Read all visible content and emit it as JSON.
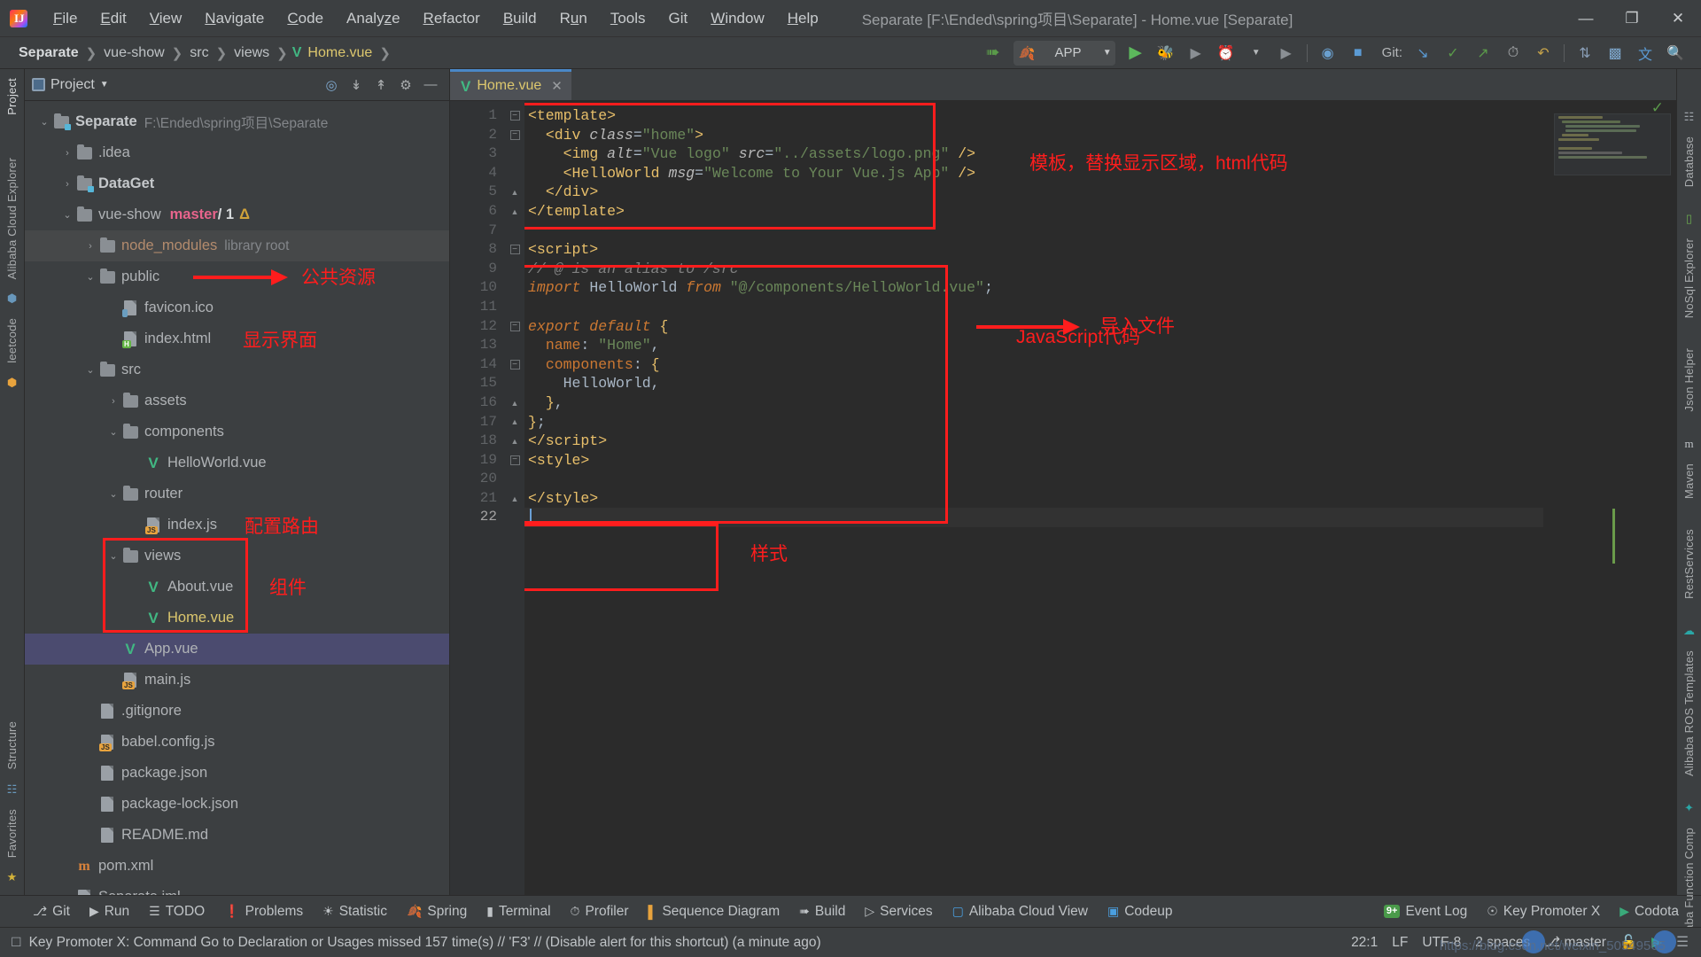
{
  "titlebar": {
    "app_icon": "intellij-idea-logo",
    "menus": [
      "File",
      "Edit",
      "View",
      "Navigate",
      "Code",
      "Analyze",
      "Refactor",
      "Build",
      "Run",
      "Tools",
      "Git",
      "Window",
      "Help"
    ],
    "window_title": "Separate [F:\\Ended\\spring项目\\Separate] - Home.vue [Separate]",
    "minimize": "—",
    "maximize": "❐",
    "close": "✕"
  },
  "navbar": {
    "breadcrumb": [
      "Separate",
      "vue-show",
      "src",
      "views",
      "Home.vue"
    ],
    "separator": "❯",
    "run_config_name": "APP",
    "git_label": "Git:",
    "icons": [
      "build-icon",
      "vcs-update-icon",
      "run-icon",
      "debug-icon",
      "coverage-icon",
      "profiler-icon",
      "run-anything-icon",
      "stop-icon",
      "help-icon",
      "settings-icon",
      "git-commit-icon",
      "git-push-icon",
      "git-pull-icon",
      "history-icon",
      "undo-icon",
      "compare-icon",
      "bookmark-icon",
      "translate-icon",
      "search-icon"
    ]
  },
  "left_rail": {
    "top": [
      "Project"
    ],
    "side": [
      "Alibaba Cloud Explorer",
      "leetcode"
    ],
    "bottom": [
      "Structure",
      "Favorites"
    ]
  },
  "project_panel": {
    "title": "Project",
    "actions": [
      "locate-icon",
      "collapse-all-icon",
      "expand-icon",
      "settings-icon",
      "hide-icon"
    ],
    "tree": [
      {
        "depth": 0,
        "arrow": "down",
        "icon": "folder-module",
        "label": "Separate",
        "bold": true,
        "sub": "F:\\Ended\\spring项目\\Separate"
      },
      {
        "depth": 1,
        "arrow": "right",
        "icon": "folder",
        "label": ".idea"
      },
      {
        "depth": 1,
        "arrow": "right",
        "icon": "folder-module",
        "label": "DataGet",
        "bold": true
      },
      {
        "depth": 1,
        "arrow": "down",
        "icon": "folder",
        "label": "vue-show",
        "branch": "master",
        "branch_num": "/ 1",
        "branch_delta": "Δ"
      },
      {
        "depth": 2,
        "arrow": "right",
        "icon": "folder",
        "label": "node_modules",
        "brown": true,
        "sub": "library root",
        "highlight": true
      },
      {
        "depth": 2,
        "arrow": "down",
        "icon": "folder",
        "label": "public"
      },
      {
        "depth": 3,
        "arrow": "none",
        "icon": "file-image",
        "label": "favicon.ico"
      },
      {
        "depth": 3,
        "arrow": "none",
        "icon": "file-html",
        "label": "index.html"
      },
      {
        "depth": 2,
        "arrow": "down",
        "icon": "folder",
        "label": "src"
      },
      {
        "depth": 3,
        "arrow": "right",
        "icon": "folder",
        "label": "assets"
      },
      {
        "depth": 3,
        "arrow": "down",
        "icon": "folder",
        "label": "components"
      },
      {
        "depth": 4,
        "arrow": "none",
        "icon": "vue",
        "label": "HelloWorld.vue"
      },
      {
        "depth": 3,
        "arrow": "down",
        "icon": "folder",
        "label": "router"
      },
      {
        "depth": 4,
        "arrow": "none",
        "icon": "file-js",
        "label": "index.js"
      },
      {
        "depth": 3,
        "arrow": "down",
        "icon": "folder",
        "label": "views"
      },
      {
        "depth": 4,
        "arrow": "none",
        "icon": "vue",
        "label": "About.vue"
      },
      {
        "depth": 4,
        "arrow": "none",
        "icon": "vue",
        "label": "Home.vue",
        "yellow": true
      },
      {
        "depth": 3,
        "arrow": "none",
        "icon": "vue",
        "label": "App.vue",
        "selected": true
      },
      {
        "depth": 3,
        "arrow": "none",
        "icon": "file-js",
        "label": "main.js"
      },
      {
        "depth": 2,
        "arrow": "none",
        "icon": "file-ignore",
        "label": ".gitignore"
      },
      {
        "depth": 2,
        "arrow": "none",
        "icon": "file-js",
        "label": "babel.config.js"
      },
      {
        "depth": 2,
        "arrow": "none",
        "icon": "file-json",
        "label": "package.json"
      },
      {
        "depth": 2,
        "arrow": "none",
        "icon": "file-json",
        "label": "package-lock.json"
      },
      {
        "depth": 2,
        "arrow": "none",
        "icon": "file-md",
        "label": "README.md"
      },
      {
        "depth": 1,
        "arrow": "none",
        "icon": "maven",
        "label": "pom.xml"
      },
      {
        "depth": 1,
        "arrow": "none",
        "icon": "file",
        "label": "Separate.iml"
      }
    ]
  },
  "editor": {
    "tab": {
      "label": "Home.vue",
      "icon": "vue-icon",
      "close": "✕"
    },
    "caret_position": "22:1",
    "lines": [
      {
        "n": 1,
        "fold": "minus",
        "html": "<span class='k-tag'>&lt;template&gt;</span>"
      },
      {
        "n": 2,
        "fold": "minus",
        "html": "  <span class='k-tag'>&lt;div </span><span class='k-attr'>class</span><span class='k-eq'>=</span><span class='k-str'>\"home\"</span><span class='k-tag'>&gt;</span>"
      },
      {
        "n": 3,
        "fold": "",
        "html": "    <span class='k-tag'>&lt;img </span><span class='k-attr'>alt</span><span class='k-eq'>=</span><span class='k-str'>\"Vue logo\"</span> <span class='k-attr'>src</span><span class='k-eq'>=</span><span class='k-str'>\"../assets/logo.png\"</span> <span class='k-tag'>/&gt;</span>"
      },
      {
        "n": 4,
        "fold": "",
        "html": "    <span class='k-tag'>&lt;HelloWorld </span><span class='k-attr'>msg</span><span class='k-eq'>=</span><span class='k-str'>\"Welcome to Your Vue.js App\"</span> <span class='k-tag'>/&gt;</span>"
      },
      {
        "n": 5,
        "fold": "plus-end",
        "html": "  <span class='k-tag'>&lt;/div&gt;</span>"
      },
      {
        "n": 6,
        "fold": "plus-end",
        "html": "<span class='k-tag'>&lt;/template&gt;</span>"
      },
      {
        "n": 7,
        "fold": "",
        "html": ""
      },
      {
        "n": 8,
        "fold": "minus",
        "html": "<span class='k-tag'>&lt;script&gt;</span>"
      },
      {
        "n": 9,
        "fold": "",
        "html": "<span class='k-cmt'>// @ is an alias to /src</span>"
      },
      {
        "n": 10,
        "fold": "",
        "html": "<span class='k-kw'>import</span> <span class='k-id'>HelloWorld</span> <span class='k-kw'>from</span> <span class='k-str'>\"@/components/HelloWorld.vue\"</span><span class='k-punc'>;</span>"
      },
      {
        "n": 11,
        "fold": "",
        "html": ""
      },
      {
        "n": 12,
        "fold": "minus",
        "html": "<span class='k-kw'>export default</span> <span class='k-brace'>{</span>"
      },
      {
        "n": 13,
        "fold": "",
        "html": "  <span class='k-kw2'>name</span><span class='k-punc'>: </span><span class='k-str'>\"Home\"</span><span class='k-punc'>,</span>"
      },
      {
        "n": 14,
        "fold": "minus",
        "html": "  <span class='k-kw2'>components</span><span class='k-punc'>: </span><span class='k-brace'>{</span>"
      },
      {
        "n": 15,
        "fold": "",
        "html": "    <span class='k-id'>HelloWorld</span><span class='k-punc'>,</span>"
      },
      {
        "n": 16,
        "fold": "plus-end",
        "html": "  <span class='k-brace'>}</span><span class='k-punc'>,</span>"
      },
      {
        "n": 17,
        "fold": "plus-end",
        "html": "<span class='k-brace'>}</span><span class='k-punc'>;</span>"
      },
      {
        "n": 18,
        "fold": "plus-end",
        "html": "<span class='k-tag'>&lt;/script&gt;</span>"
      },
      {
        "n": 19,
        "fold": "minus",
        "html": "<span class='k-tag'>&lt;style&gt;</span>"
      },
      {
        "n": 20,
        "fold": "",
        "html": ""
      },
      {
        "n": 21,
        "fold": "plus-end",
        "html": "<span class='k-tag'>&lt;/style&gt;</span>"
      },
      {
        "n": 22,
        "fold": "",
        "html": "",
        "current": true
      }
    ]
  },
  "annotations": [
    {
      "id": "ann-template",
      "text": "模板，替换显示区域，html代码",
      "type": "box"
    },
    {
      "id": "ann-import",
      "text": "导入文件",
      "type": "arrow"
    },
    {
      "id": "ann-javascript",
      "text": "JavaScript代码",
      "type": "box"
    },
    {
      "id": "ann-style",
      "text": "样式",
      "type": "box"
    },
    {
      "id": "ann-public",
      "text": "公共资源",
      "type": "arrow"
    },
    {
      "id": "ann-index-html",
      "text": "显示界面",
      "type": "text"
    },
    {
      "id": "ann-router",
      "text": "配置路由",
      "type": "text"
    },
    {
      "id": "ann-views",
      "text": "组件",
      "type": "box"
    }
  ],
  "right_rail": {
    "items": [
      "Database",
      "NoSql Explorer",
      "Json Helper",
      "Maven",
      "RestServices",
      "Alibaba ROS Templates",
      "Alibaba Function Comp"
    ]
  },
  "toolwindow_bar": {
    "items": [
      {
        "label": "Git",
        "icon": "git-icon"
      },
      {
        "label": "Run",
        "icon": "run-icon"
      },
      {
        "label": "TODO",
        "icon": "todo-icon"
      },
      {
        "label": "Problems",
        "icon": "problems-icon"
      },
      {
        "label": "Statistic",
        "icon": "statistic-icon"
      },
      {
        "label": "Spring",
        "icon": "spring-leaf-icon"
      },
      {
        "label": "Terminal",
        "icon": "terminal-icon"
      },
      {
        "label": "Profiler",
        "icon": "profiler-icon"
      },
      {
        "label": "Sequence Diagram",
        "icon": "sequence-diagram-icon"
      },
      {
        "label": "Build",
        "icon": "build-hammer-icon"
      },
      {
        "label": "Services",
        "icon": "services-icon"
      },
      {
        "label": "Alibaba Cloud View",
        "icon": "alibaba-cloud-icon"
      },
      {
        "label": "Codeup",
        "icon": "codeup-icon"
      }
    ],
    "right_items": [
      {
        "label": "Event Log",
        "icon": "event-log-icon",
        "badge": "9+"
      },
      {
        "label": "Key Promoter X",
        "icon": "key-promoter-icon"
      },
      {
        "label": "Codota",
        "icon": "codota-icon"
      }
    ]
  },
  "statusbar": {
    "message_icon": "notification-icon",
    "message": "Key Promoter X: Command Go to Declaration or Usages missed 157 time(s) // 'F3' // (Disable alert for this shortcut) (a minute ago)",
    "caret": "22:1",
    "line_separator": "LF",
    "encoding": "UTF-8",
    "indent": "2 spaces",
    "branch": "master",
    "lock_icon": "lock-icon",
    "codota_icon": "codota-icon",
    "watermark": "https://blog.csdn.net/weixin_50549565"
  },
  "colors": {
    "accent_red": "#ff1d1d",
    "vue_green": "#41b883",
    "tab_underline": "#4a88c7",
    "selection": "#4b4b6f",
    "panel_bg": "#3c3f41",
    "editor_bg": "#2b2b2b",
    "gutter_bg": "#313335"
  }
}
